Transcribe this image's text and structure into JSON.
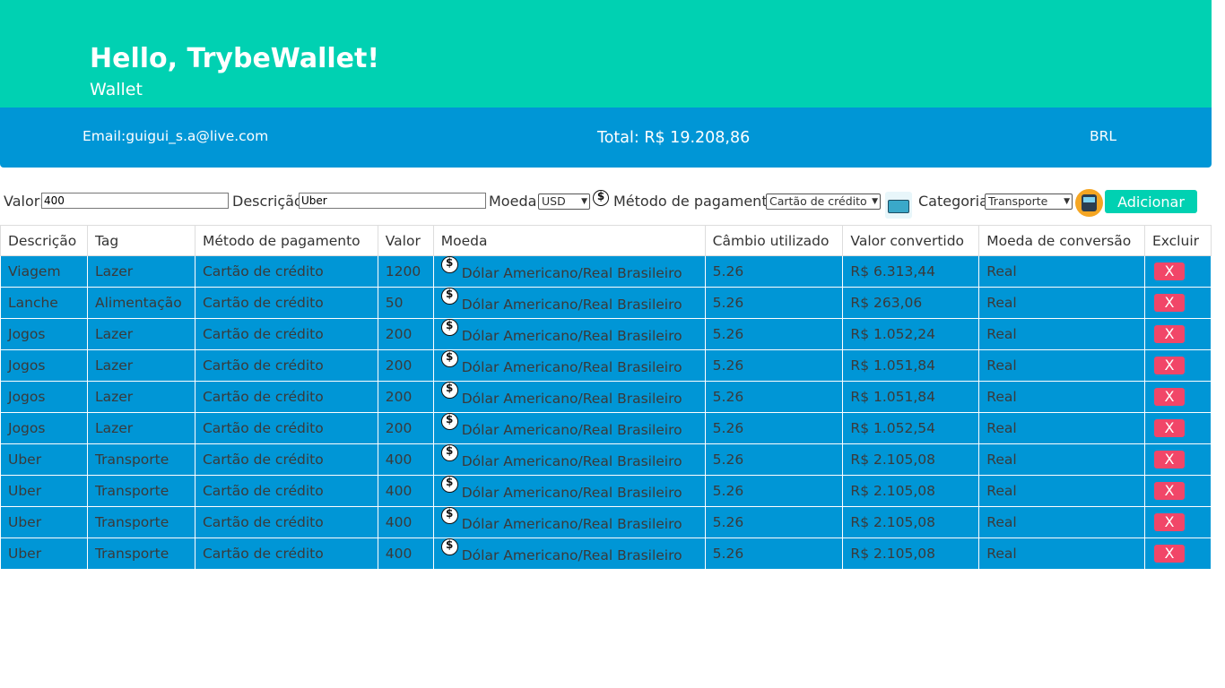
{
  "header": {
    "title": "Hello, TrybeWallet!",
    "subtitle": "Wallet"
  },
  "info": {
    "email": "Email:guigui_s.a@live.com",
    "total": "Total: R$ 19.208,86",
    "currency": "BRL"
  },
  "form": {
    "valor_label": "Valor:",
    "valor_value": "400",
    "descricao_label": "Descrição:",
    "descricao_value": "Uber",
    "moeda_label": "Moeda:",
    "moeda_value": "USD",
    "metodo_label": "Método de pagamento:",
    "metodo_value": "Cartão de crédito",
    "categoria_label": "Categoria:",
    "categoria_value": "Transporte",
    "add_label": "Adicionar"
  },
  "table": {
    "headers": [
      "Descrição",
      "Tag",
      "Método de pagamento",
      "Valor",
      "Moeda",
      "Câmbio utilizado",
      "Valor convertido",
      "Moeda de conversão",
      "Excluir"
    ],
    "delete_label": "X",
    "rows": [
      {
        "descricao": "Viagem",
        "tag": "Lazer",
        "metodo": "Cartão de crédito",
        "valor": "1200",
        "moeda": "Dólar Americano/Real Brasileiro",
        "cambio": "5.26",
        "convertido": "R$ 6.313,44",
        "conversao": "Real"
      },
      {
        "descricao": "Lanche",
        "tag": "Alimentação",
        "metodo": "Cartão de crédito",
        "valor": "50",
        "moeda": "Dólar Americano/Real Brasileiro",
        "cambio": "5.26",
        "convertido": "R$ 263,06",
        "conversao": "Real"
      },
      {
        "descricao": "Jogos",
        "tag": "Lazer",
        "metodo": "Cartão de crédito",
        "valor": "200",
        "moeda": "Dólar Americano/Real Brasileiro",
        "cambio": "5.26",
        "convertido": "R$ 1.052,24",
        "conversao": "Real"
      },
      {
        "descricao": "Jogos",
        "tag": "Lazer",
        "metodo": "Cartão de crédito",
        "valor": "200",
        "moeda": "Dólar Americano/Real Brasileiro",
        "cambio": "5.26",
        "convertido": "R$ 1.051,84",
        "conversao": "Real"
      },
      {
        "descricao": "Jogos",
        "tag": "Lazer",
        "metodo": "Cartão de crédito",
        "valor": "200",
        "moeda": "Dólar Americano/Real Brasileiro",
        "cambio": "5.26",
        "convertido": "R$ 1.051,84",
        "conversao": "Real"
      },
      {
        "descricao": "Jogos",
        "tag": "Lazer",
        "metodo": "Cartão de crédito",
        "valor": "200",
        "moeda": "Dólar Americano/Real Brasileiro",
        "cambio": "5.26",
        "convertido": "R$ 1.052,54",
        "conversao": "Real"
      },
      {
        "descricao": "Uber",
        "tag": "Transporte",
        "metodo": "Cartão de crédito",
        "valor": "400",
        "moeda": "Dólar Americano/Real Brasileiro",
        "cambio": "5.26",
        "convertido": "R$ 2.105,08",
        "conversao": "Real"
      },
      {
        "descricao": "Uber",
        "tag": "Transporte",
        "metodo": "Cartão de crédito",
        "valor": "400",
        "moeda": "Dólar Americano/Real Brasileiro",
        "cambio": "5.26",
        "convertido": "R$ 2.105,08",
        "conversao": "Real"
      },
      {
        "descricao": "Uber",
        "tag": "Transporte",
        "metodo": "Cartão de crédito",
        "valor": "400",
        "moeda": "Dólar Americano/Real Brasileiro",
        "cambio": "5.26",
        "convertido": "R$ 2.105,08",
        "conversao": "Real"
      },
      {
        "descricao": "Uber",
        "tag": "Transporte",
        "metodo": "Cartão de crédito",
        "valor": "400",
        "moeda": "Dólar Americano/Real Brasileiro",
        "cambio": "5.26",
        "convertido": "R$ 2.105,08",
        "conversao": "Real"
      }
    ]
  },
  "icons": {
    "coin": "dollar-coin-icon",
    "payment": "credit-card-icon",
    "category": "bus-icon"
  },
  "colors": {
    "header": "#00d1b2",
    "info_bar": "#0096d6",
    "row": "#0096d6",
    "delete": "#f14668"
  }
}
